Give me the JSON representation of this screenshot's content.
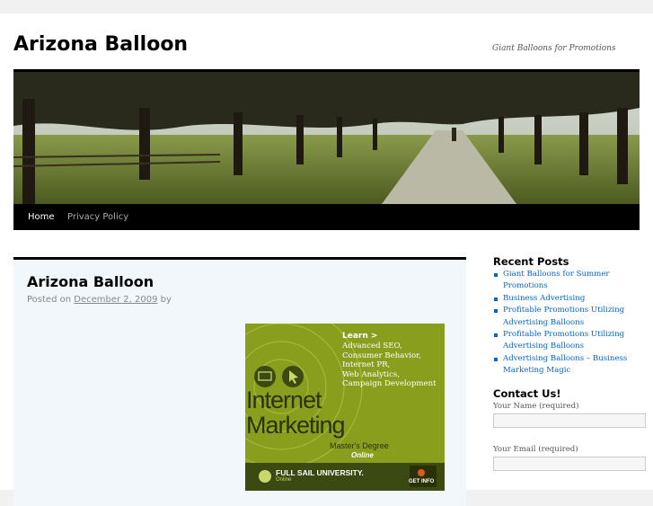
{
  "site": {
    "title": "Arizona Balloon",
    "tagline": "Giant Balloons for Promotions"
  },
  "nav": {
    "items": [
      "Home",
      "Privacy Policy"
    ]
  },
  "post": {
    "title": "Arizona Balloon",
    "posted_on": "Posted on",
    "date": "December 2, 2009",
    "by": "by"
  },
  "ad": {
    "learn": "Learn >",
    "topics": [
      "Advanced SEO,",
      "Consumer Behavior,",
      "Internet PR,",
      "Web Analytics,",
      "Campaign Development"
    ],
    "headline_1": "Internet",
    "headline_2": "Marketing",
    "degree": "Master's Degree",
    "online": "Online",
    "school": "FULL SAIL UNIVERSITY.",
    "school_sub": "Online",
    "cta": "GET INFO"
  },
  "sidebar": {
    "recent_posts_title": "Recent Posts",
    "recent_posts": [
      "Giant Balloons for Summer Promotions",
      "Business Advertising",
      "Profitable Promotions Utilizing Advertising Balloons",
      "Profitable Promotions Utilizing Advertising Balloons",
      "Advertising Balloons – Business Marketing Magic"
    ],
    "contact_title": "Contact Us!",
    "name_label": "Your Name (required)",
    "email_label": "Your Email (required)"
  },
  "colors": {
    "link": "#0066cc",
    "nav_bg": "#000000",
    "post_bg": "#f2f7fc",
    "ad_green": "#8a9e1e"
  }
}
